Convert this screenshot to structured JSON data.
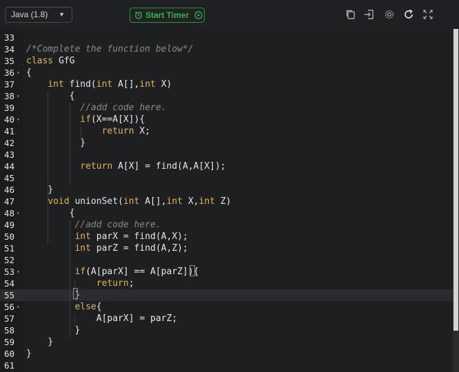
{
  "toolbar": {
    "language": "Java (1.8)",
    "timer_label": "Start Timer"
  },
  "code_lines": [
    {
      "n": "33",
      "fold": false,
      "html": ""
    },
    {
      "n": "34",
      "fold": false,
      "html": "<span class=\"cm\">/*Complete the function below*/</span>"
    },
    {
      "n": "35",
      "fold": false,
      "html": "<span class=\"kw\">class</span> GfG"
    },
    {
      "n": "36",
      "fold": true,
      "html": "{"
    },
    {
      "n": "37",
      "fold": false,
      "html": "    <span class=\"kw\">int</span> find(<span class=\"kw\">int</span> A[],<span class=\"kw\">int</span> X)"
    },
    {
      "n": "38",
      "fold": true,
      "html": "        {"
    },
    {
      "n": "39",
      "fold": false,
      "html": "          <span class=\"cm\">//add code here.</span>"
    },
    {
      "n": "40",
      "fold": true,
      "html": "          <span class=\"kw\">if</span>(X==A[X]){"
    },
    {
      "n": "41",
      "fold": false,
      "html": "              <span class=\"kw\">return</span> X;"
    },
    {
      "n": "42",
      "fold": false,
      "html": "          }"
    },
    {
      "n": "43",
      "fold": false,
      "html": ""
    },
    {
      "n": "44",
      "fold": false,
      "html": "          <span class=\"kw\">return</span> A[X] = find(A,A[X]);"
    },
    {
      "n": "45",
      "fold": false,
      "html": ""
    },
    {
      "n": "46",
      "fold": false,
      "html": "    }"
    },
    {
      "n": "47",
      "fold": false,
      "html": "    <span class=\"kw\">void</span> unionSet(<span class=\"kw\">int</span> A[],<span class=\"kw\">int</span> X,<span class=\"kw\">int</span> Z)"
    },
    {
      "n": "48",
      "fold": true,
      "html": "        {"
    },
    {
      "n": "49",
      "fold": false,
      "html": "         <span class=\"cm\">//add code here.</span>"
    },
    {
      "n": "50",
      "fold": false,
      "html": "         <span class=\"kw\">int</span> parX = find(A,X);"
    },
    {
      "n": "51",
      "fold": false,
      "html": "         <span class=\"kw\">int</span> parZ = find(A,Z);"
    },
    {
      "n": "52",
      "fold": false,
      "html": ""
    },
    {
      "n": "53",
      "fold": true,
      "html": "         <span class=\"kw\">if</span>(A[parX] == A[parZ]){"
    },
    {
      "n": "54",
      "fold": false,
      "html": "             <span class=\"kw\">return</span>;"
    },
    {
      "n": "55",
      "fold": false,
      "html": "         }",
      "active": true
    },
    {
      "n": "56",
      "fold": true,
      "html": "         <span class=\"kw\">else</span>{"
    },
    {
      "n": "57",
      "fold": false,
      "html": "             A[parX] = parZ;"
    },
    {
      "n": "58",
      "fold": false,
      "html": "         }"
    },
    {
      "n": "59",
      "fold": false,
      "html": "    }"
    },
    {
      "n": "60",
      "fold": false,
      "html": "}"
    },
    {
      "n": "61",
      "fold": false,
      "html": ""
    }
  ]
}
